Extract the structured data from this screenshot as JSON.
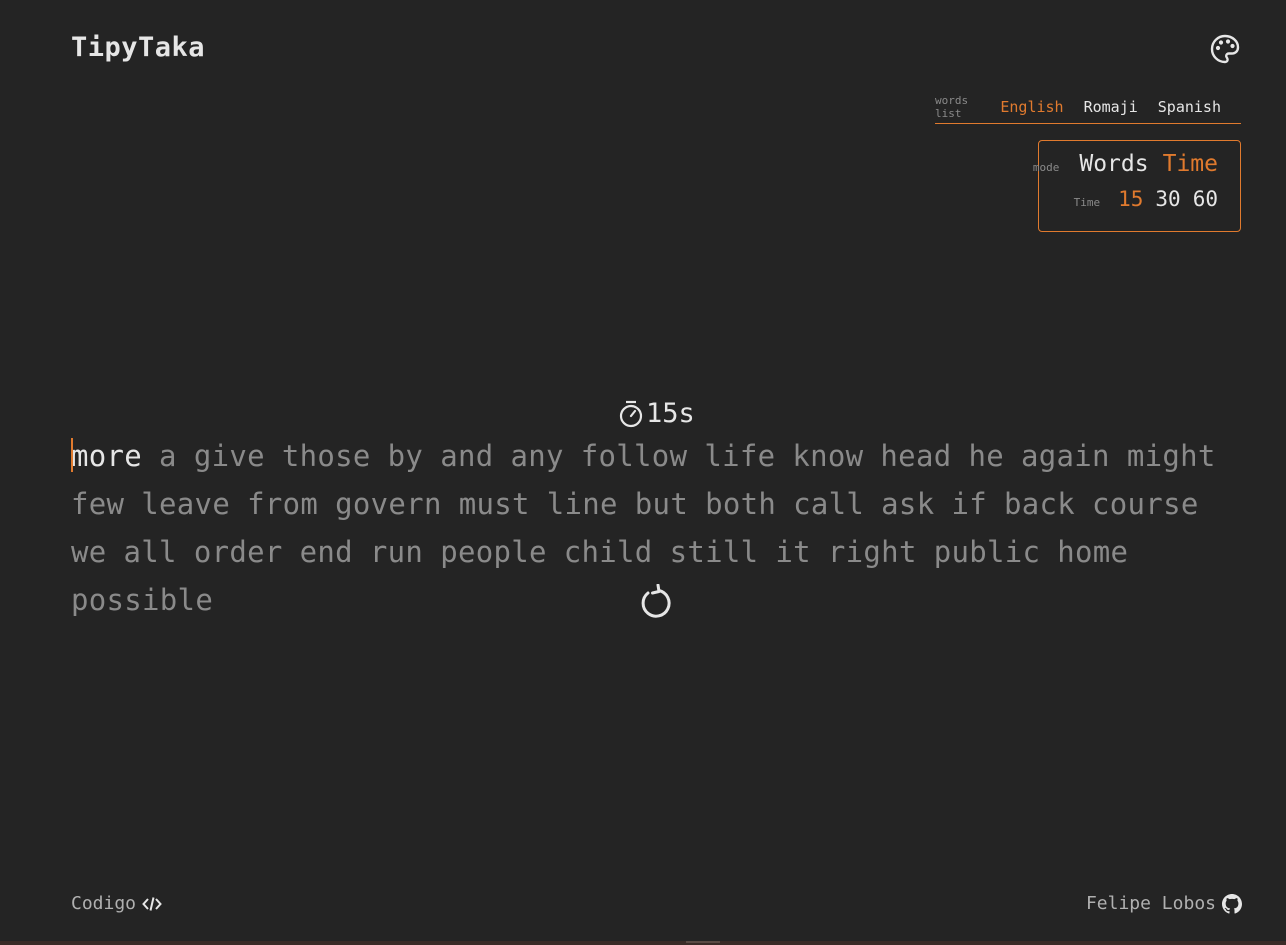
{
  "app": {
    "title": "TipyTaka"
  },
  "theme": {
    "icon": "palette-icon",
    "accent": "#e07a2e",
    "background": "#242424"
  },
  "words_list": {
    "label": "words list",
    "options": [
      "English",
      "Romaji",
      "Spanish"
    ],
    "selected": "English"
  },
  "mode": {
    "label": "mode",
    "options": [
      "Words",
      "Time"
    ],
    "selected": "Time",
    "time_label": "Time",
    "time_options": [
      "15",
      "30",
      "60"
    ],
    "time_selected": "15"
  },
  "timer": {
    "icon": "stopwatch-icon",
    "value": "15s"
  },
  "typing": {
    "words": [
      "more",
      "a",
      "give",
      "those",
      "by",
      "and",
      "any",
      "follow",
      "life",
      "know",
      "head",
      "he",
      "again",
      "might",
      "few",
      "leave",
      "from",
      "govern",
      "must",
      "line",
      "but",
      "both",
      "call",
      "ask",
      "if",
      "back",
      "course",
      "we",
      "all",
      "order",
      "end",
      "run",
      "people",
      "child",
      "still",
      "it",
      "right",
      "public",
      "home",
      "possible"
    ],
    "current_index": 0
  },
  "restart": {
    "icon": "restart-icon"
  },
  "footer": {
    "left_label": "Codigo",
    "left_icon": "code-icon",
    "right_label": "Felipe Lobos",
    "right_icon": "github-icon"
  }
}
